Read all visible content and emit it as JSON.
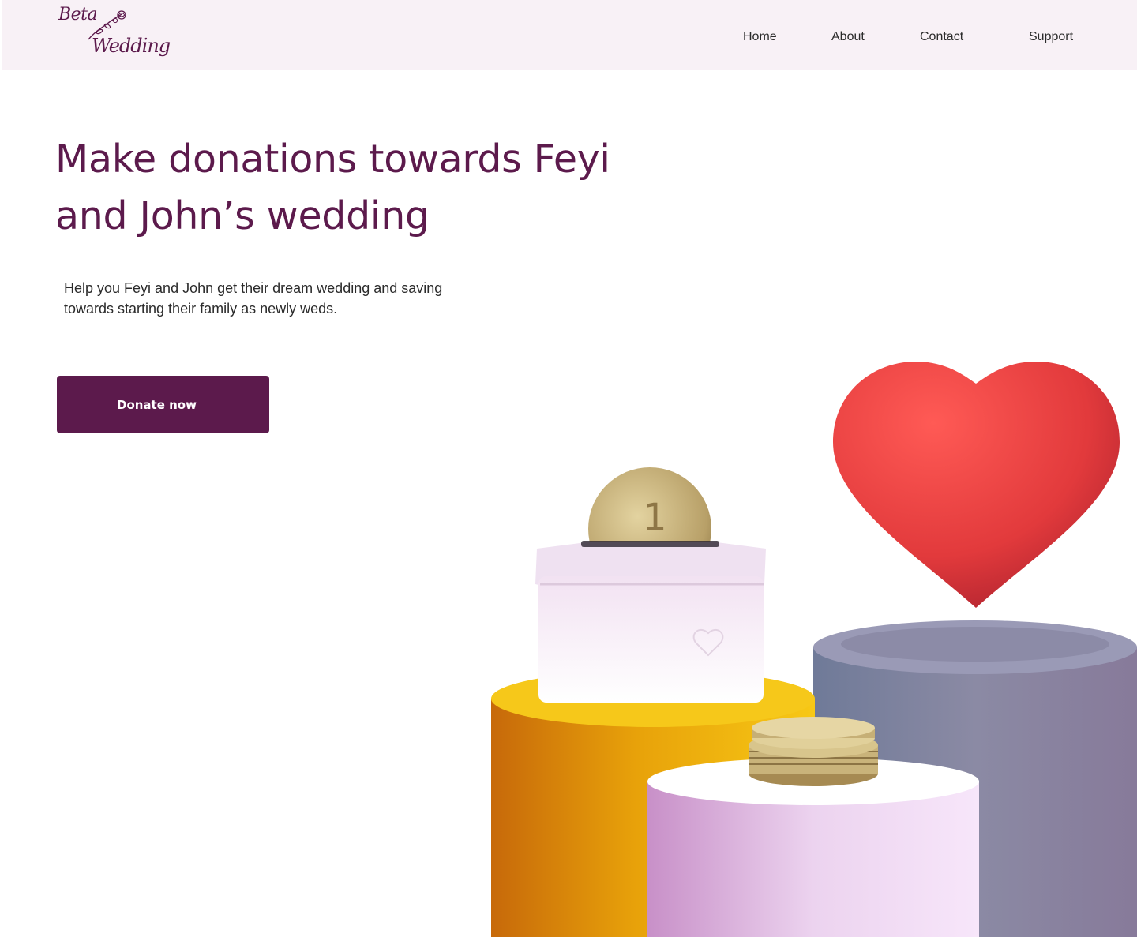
{
  "brand": {
    "line1": "Beta",
    "line2": "Wedding",
    "color": "#5c1a4c"
  },
  "nav": {
    "home": "Home",
    "about": "About",
    "contact": "Contact",
    "support": "Support"
  },
  "hero": {
    "title": "Make donations towards Feyi and John’s wedding",
    "subtitle": "Help you Feyi and John get their dream wedding and saving towards starting their family as newly weds.",
    "cta": "Donate now"
  },
  "colors": {
    "accent": "#5c1a4c",
    "nav_background": "#f8f1f6",
    "heart": "#e53a3a",
    "coin": "#c8b27a"
  },
  "illustration": {
    "coin_numeral": "1"
  }
}
